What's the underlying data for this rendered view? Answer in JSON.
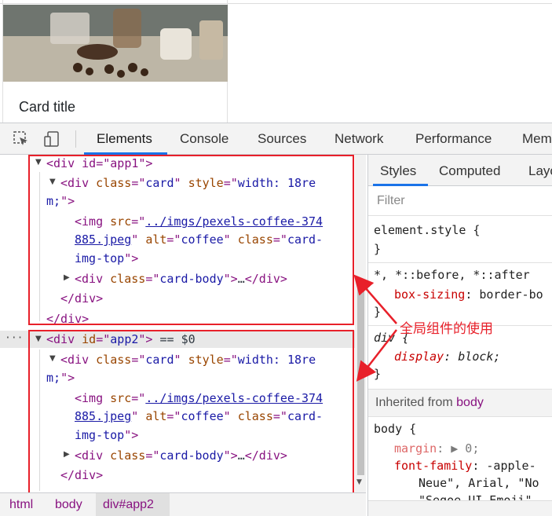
{
  "preview": {
    "card_title": "Card title"
  },
  "toolbar": {
    "tabs": [
      "Elements",
      "Console",
      "Sources",
      "Network",
      "Performance",
      "Mem"
    ],
    "active_tab": "Elements"
  },
  "elements": {
    "app1": {
      "open": "<div id=\"app1\">",
      "card_open_a": "<div class=\"card\" style=\"width: 18re",
      "card_open_b": "m;\">",
      "img_a_pre": "<img src=\"",
      "img_a_link": "../imgs/pexels-coffee-374",
      "img_b_link": "885.jpeg",
      "img_b_rest": "\" alt=\"coffee\" class=\"card-",
      "img_c": "img-top\">",
      "card_body": "<div class=\"card-body\">…</div>",
      "card_close": "</div>",
      "close": "</div>"
    },
    "app2": {
      "open": "<div id=\"app2\">",
      "selected_suffix": " == $0",
      "card_open_a": "<div class=\"card\" style=\"width: 18re",
      "card_open_b": "m;\">",
      "img_a_pre": "<img src=\"",
      "img_a_link": "../imgs/pexels-coffee-374",
      "img_b_link": "885.jpeg",
      "img_b_rest": "\" alt=\"coffee\" class=\"card-",
      "img_c": "img-top\">",
      "card_body": "<div class=\"card-body\">…</div>",
      "card_close": "</div>"
    },
    "dots": "···"
  },
  "breadcrumb": [
    "html",
    "body",
    "div#app2"
  ],
  "styles": {
    "tabs": [
      "Styles",
      "Computed",
      "Layo"
    ],
    "filter_placeholder": "Filter",
    "element_style": "element.style {",
    "close_brace": "}",
    "universal_selector": "*, *::before, *::after",
    "box_sizing_prop": "box-sizing",
    "box_sizing_val": ": border-bo",
    "div_selector": "div {",
    "display_prop": "display",
    "display_val": ": block;",
    "inherited_label": "Inherited from ",
    "inherited_from": "body",
    "body_selector": "body {",
    "margin_prop": "margin",
    "margin_val": ": ▶ 0;",
    "font_family_prop": "font-family",
    "font_family_val": ": -apple-",
    "font_line2": "Neue\", Arial, \"No",
    "font_line3": "\"Segoe UI Emoji\","
  },
  "annotation": {
    "text": "全局组件的使用",
    "color": "#e8202a"
  },
  "colors": {
    "tag": "#881280",
    "attr": "#994500",
    "value": "#1a1aa6",
    "accent": "#1a73e8",
    "css_prop": "#c80000"
  }
}
